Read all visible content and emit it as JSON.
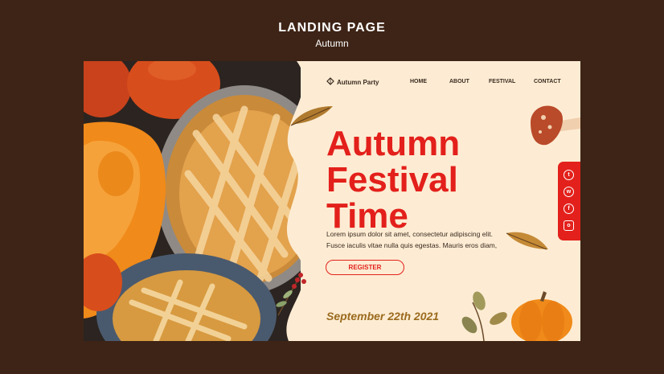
{
  "header": {
    "title": "LANDING PAGE",
    "subtitle": "Autumn"
  },
  "nav": {
    "logo": "Autumn Party",
    "items": [
      "HOME",
      "ABOUT",
      "FESTIVAL",
      "CONTACT"
    ]
  },
  "hero": {
    "title_lines": [
      "Autumn",
      "Festival",
      "Time"
    ],
    "description_lines": [
      "Lorem ipsum dolor sit amet, consectetur adipiscing elit.",
      "Fusce iaculis vitae nulla quis egestas. Mauris eros diam,"
    ],
    "register_label": "REGISTER",
    "date": "September 22th 2021"
  },
  "social_icons": [
    "twitter-icon",
    "whatsapp-icon",
    "facebook-icon",
    "instagram-icon"
  ],
  "colors": {
    "accent": "#e3201b",
    "background": "#fdecd3",
    "frame": "#3e2416",
    "date": "#9b6a1e"
  }
}
